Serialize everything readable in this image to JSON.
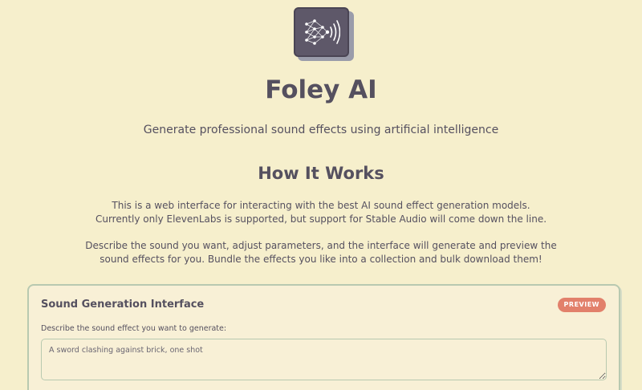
{
  "app": {
    "title": "Foley AI",
    "subtitle": "Generate professional sound effects using artificial intelligence",
    "logo_icon": "neural-network-sound-icon"
  },
  "how_it_works": {
    "title": "How It Works",
    "para1_line1": "This is a web interface for interacting with the best AI sound effect generation models.",
    "para1_line2": "Currently only ElevenLabs is supported, but support for Stable Audio will come down the line.",
    "para2_line1": "Describe the sound you want, adjust parameters, and the interface will generate and preview the",
    "para2_line2": "sound effects for you. Bundle the effects you like into a collection and bulk download them!"
  },
  "generator": {
    "title": "Sound Generation Interface",
    "badge": "PREVIEW",
    "prompt_label": "Describe the sound effect you want to generate:",
    "prompt_placeholder": "A sword clashing against brick, one shot",
    "prompt_value": ""
  },
  "colors": {
    "background": "#f6efcc",
    "text": "#55505f",
    "logo_bg": "#5e5869",
    "badge": "#e2806b",
    "border": "#b8c9b0"
  }
}
